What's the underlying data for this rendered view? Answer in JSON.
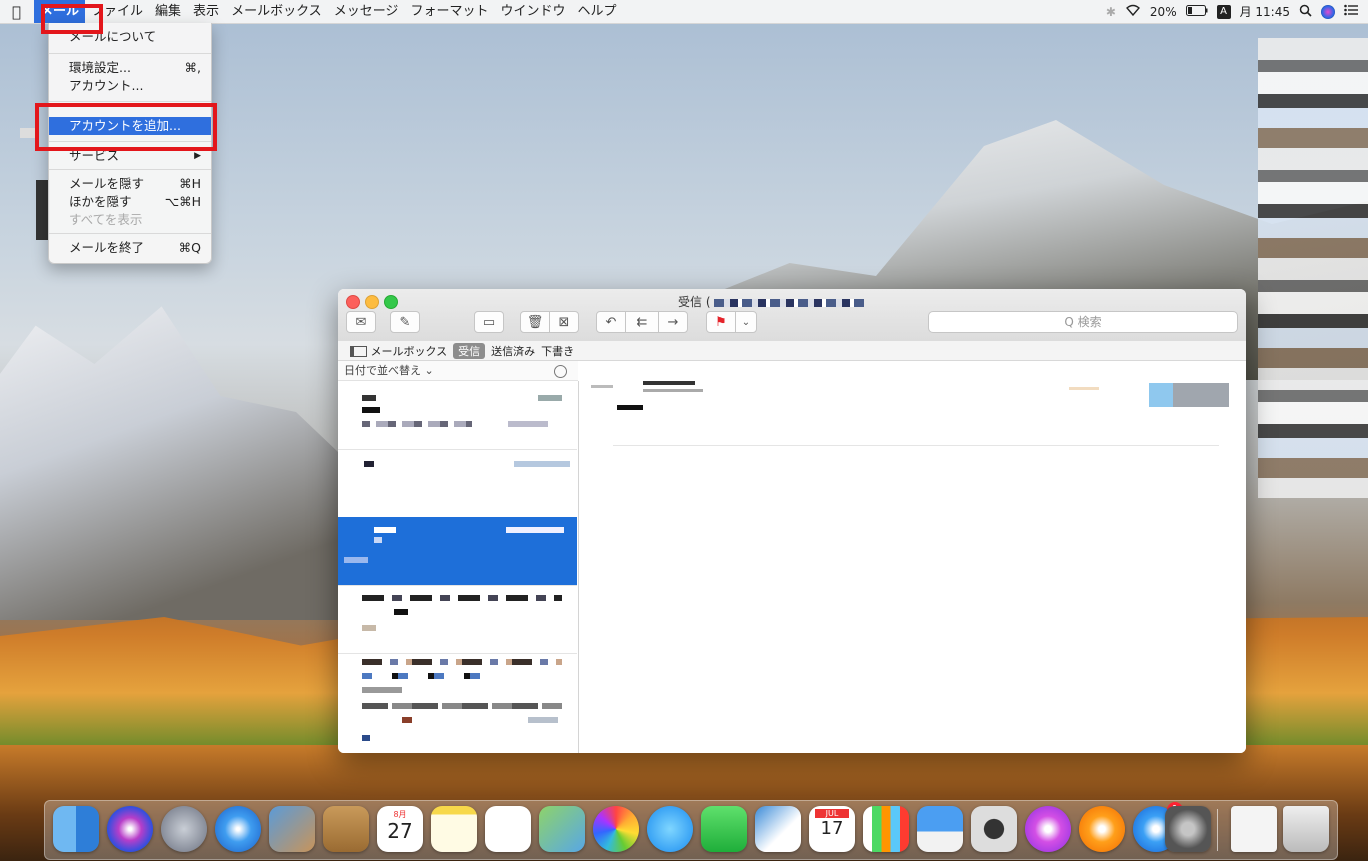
{
  "menubar": {
    "app_menu": "メール",
    "items": [
      "ファイル",
      "編集",
      "表示",
      "メールボックス",
      "メッセージ",
      "フォーマット",
      "ウインドウ",
      "ヘルプ"
    ],
    "status": {
      "battery": "20%",
      "ime": "A",
      "clock": "月 11:45"
    }
  },
  "mail_menu": {
    "about": "メールについて",
    "preferences": "環境設定...",
    "preferences_shortcut": "⌘,",
    "accounts": "アカウント...",
    "add_account": "アカウントを追加...",
    "services": "サービス",
    "services_arrow": "▶",
    "hide_mail": "メールを隠す",
    "hide_mail_shortcut": "⌘H",
    "hide_others": "ほかを隠す",
    "hide_others_shortcut": "⌥⌘H",
    "show_all": "すべてを表示",
    "quit": "メールを終了",
    "quit_shortcut": "⌘Q"
  },
  "window": {
    "title": "受信 (",
    "search_placeholder": "Q 検索",
    "favorites": {
      "mailboxes": "メールボックス",
      "inbox": "受信",
      "sent": "送信済み",
      "drafts": "下書き"
    },
    "sort_label": "日付で並べ替え ⌄"
  },
  "dock": {
    "calendar_month": "8月",
    "calendar_day": "27",
    "ical_month": "JUL",
    "ical_day": "17",
    "appstore_badge": "1"
  },
  "colors": {
    "accent": "#2f6fde",
    "highlight_box": "#e3161b",
    "selected_row": "#1e6fd9"
  }
}
